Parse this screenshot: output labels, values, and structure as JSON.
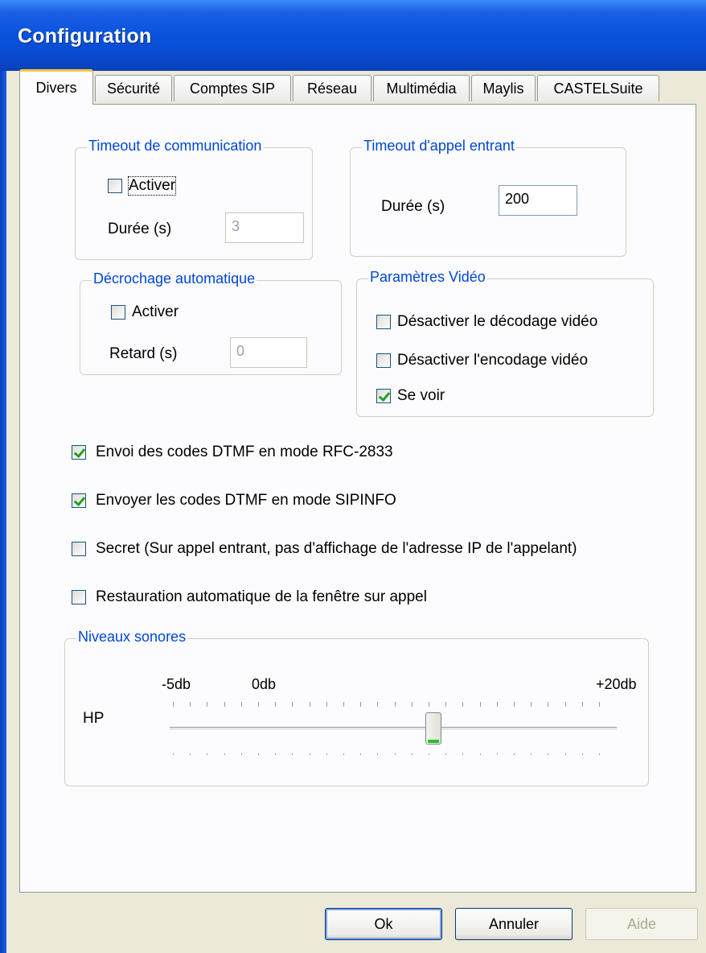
{
  "window": {
    "title": "Configuration"
  },
  "tabs": [
    "Divers",
    "Sécurité",
    "Comptes SIP",
    "Réseau",
    "Multimédia",
    "Maylis",
    "CASTELSuite"
  ],
  "timeout_communication": {
    "label": "Timeout de communication",
    "activate_label": "Activer",
    "activate_checked": false,
    "duration_label": "Durée (s)",
    "duration_value": "3"
  },
  "timeout_incoming": {
    "label": "Timeout d'appel entrant",
    "duration_label": "Durée (s)",
    "duration_value": "200"
  },
  "auto_answer": {
    "label": "Décrochage automatique",
    "activate_label": "Activer",
    "activate_checked": false,
    "delay_label": "Retard (s)",
    "delay_value": "0"
  },
  "video": {
    "label": "Paramètres Vidéo",
    "options": [
      {
        "label": "Désactiver le décodage vidéo",
        "checked": false
      },
      {
        "label": "Désactiver l'encodage vidéo",
        "checked": false
      },
      {
        "label": "Se voir",
        "checked": true
      }
    ]
  },
  "options": [
    {
      "label": "Envoi des codes DTMF en mode RFC-2833",
      "checked": true
    },
    {
      "label": "Envoyer les codes DTMF en mode SIPINFO",
      "checked": true
    },
    {
      "label": "Secret (Sur appel entrant, pas d'affichage de l'adresse IP de l'appelant)",
      "checked": false
    },
    {
      "label": "Restauration automatique de la fenêtre sur appel",
      "checked": false
    }
  ],
  "sound": {
    "label": "Niveaux sonores",
    "hp_label": "HP",
    "min_label": "-5db",
    "zero_label": "0db",
    "max_label": "+20db",
    "slider_value_fraction": 0.59
  },
  "buttons": {
    "ok": "Ok",
    "cancel": "Annuler",
    "help": "Aide"
  }
}
